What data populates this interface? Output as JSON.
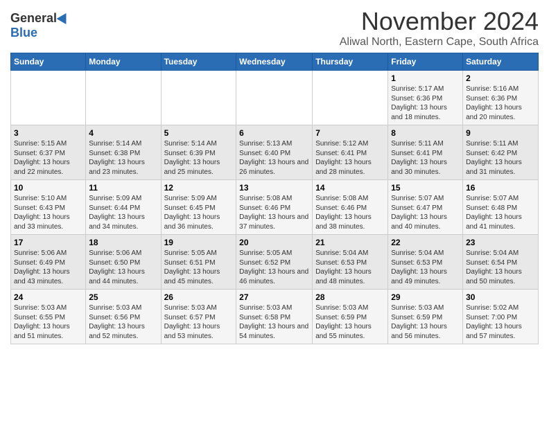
{
  "header": {
    "logo_general": "General",
    "logo_blue": "Blue",
    "month_title": "November 2024",
    "location": "Aliwal North, Eastern Cape, South Africa"
  },
  "weekdays": [
    "Sunday",
    "Monday",
    "Tuesday",
    "Wednesday",
    "Thursday",
    "Friday",
    "Saturday"
  ],
  "weeks": [
    [
      {
        "day": "",
        "info": ""
      },
      {
        "day": "",
        "info": ""
      },
      {
        "day": "",
        "info": ""
      },
      {
        "day": "",
        "info": ""
      },
      {
        "day": "",
        "info": ""
      },
      {
        "day": "1",
        "info": "Sunrise: 5:17 AM\nSunset: 6:36 PM\nDaylight: 13 hours and 18 minutes."
      },
      {
        "day": "2",
        "info": "Sunrise: 5:16 AM\nSunset: 6:36 PM\nDaylight: 13 hours and 20 minutes."
      }
    ],
    [
      {
        "day": "3",
        "info": "Sunrise: 5:15 AM\nSunset: 6:37 PM\nDaylight: 13 hours and 22 minutes."
      },
      {
        "day": "4",
        "info": "Sunrise: 5:14 AM\nSunset: 6:38 PM\nDaylight: 13 hours and 23 minutes."
      },
      {
        "day": "5",
        "info": "Sunrise: 5:14 AM\nSunset: 6:39 PM\nDaylight: 13 hours and 25 minutes."
      },
      {
        "day": "6",
        "info": "Sunrise: 5:13 AM\nSunset: 6:40 PM\nDaylight: 13 hours and 26 minutes."
      },
      {
        "day": "7",
        "info": "Sunrise: 5:12 AM\nSunset: 6:41 PM\nDaylight: 13 hours and 28 minutes."
      },
      {
        "day": "8",
        "info": "Sunrise: 5:11 AM\nSunset: 6:41 PM\nDaylight: 13 hours and 30 minutes."
      },
      {
        "day": "9",
        "info": "Sunrise: 5:11 AM\nSunset: 6:42 PM\nDaylight: 13 hours and 31 minutes."
      }
    ],
    [
      {
        "day": "10",
        "info": "Sunrise: 5:10 AM\nSunset: 6:43 PM\nDaylight: 13 hours and 33 minutes."
      },
      {
        "day": "11",
        "info": "Sunrise: 5:09 AM\nSunset: 6:44 PM\nDaylight: 13 hours and 34 minutes."
      },
      {
        "day": "12",
        "info": "Sunrise: 5:09 AM\nSunset: 6:45 PM\nDaylight: 13 hours and 36 minutes."
      },
      {
        "day": "13",
        "info": "Sunrise: 5:08 AM\nSunset: 6:46 PM\nDaylight: 13 hours and 37 minutes."
      },
      {
        "day": "14",
        "info": "Sunrise: 5:08 AM\nSunset: 6:46 PM\nDaylight: 13 hours and 38 minutes."
      },
      {
        "day": "15",
        "info": "Sunrise: 5:07 AM\nSunset: 6:47 PM\nDaylight: 13 hours and 40 minutes."
      },
      {
        "day": "16",
        "info": "Sunrise: 5:07 AM\nSunset: 6:48 PM\nDaylight: 13 hours and 41 minutes."
      }
    ],
    [
      {
        "day": "17",
        "info": "Sunrise: 5:06 AM\nSunset: 6:49 PM\nDaylight: 13 hours and 43 minutes."
      },
      {
        "day": "18",
        "info": "Sunrise: 5:06 AM\nSunset: 6:50 PM\nDaylight: 13 hours and 44 minutes."
      },
      {
        "day": "19",
        "info": "Sunrise: 5:05 AM\nSunset: 6:51 PM\nDaylight: 13 hours and 45 minutes."
      },
      {
        "day": "20",
        "info": "Sunrise: 5:05 AM\nSunset: 6:52 PM\nDaylight: 13 hours and 46 minutes."
      },
      {
        "day": "21",
        "info": "Sunrise: 5:04 AM\nSunset: 6:53 PM\nDaylight: 13 hours and 48 minutes."
      },
      {
        "day": "22",
        "info": "Sunrise: 5:04 AM\nSunset: 6:53 PM\nDaylight: 13 hours and 49 minutes."
      },
      {
        "day": "23",
        "info": "Sunrise: 5:04 AM\nSunset: 6:54 PM\nDaylight: 13 hours and 50 minutes."
      }
    ],
    [
      {
        "day": "24",
        "info": "Sunrise: 5:03 AM\nSunset: 6:55 PM\nDaylight: 13 hours and 51 minutes."
      },
      {
        "day": "25",
        "info": "Sunrise: 5:03 AM\nSunset: 6:56 PM\nDaylight: 13 hours and 52 minutes."
      },
      {
        "day": "26",
        "info": "Sunrise: 5:03 AM\nSunset: 6:57 PM\nDaylight: 13 hours and 53 minutes."
      },
      {
        "day": "27",
        "info": "Sunrise: 5:03 AM\nSunset: 6:58 PM\nDaylight: 13 hours and 54 minutes."
      },
      {
        "day": "28",
        "info": "Sunrise: 5:03 AM\nSunset: 6:59 PM\nDaylight: 13 hours and 55 minutes."
      },
      {
        "day": "29",
        "info": "Sunrise: 5:03 AM\nSunset: 6:59 PM\nDaylight: 13 hours and 56 minutes."
      },
      {
        "day": "30",
        "info": "Sunrise: 5:02 AM\nSunset: 7:00 PM\nDaylight: 13 hours and 57 minutes."
      }
    ]
  ]
}
